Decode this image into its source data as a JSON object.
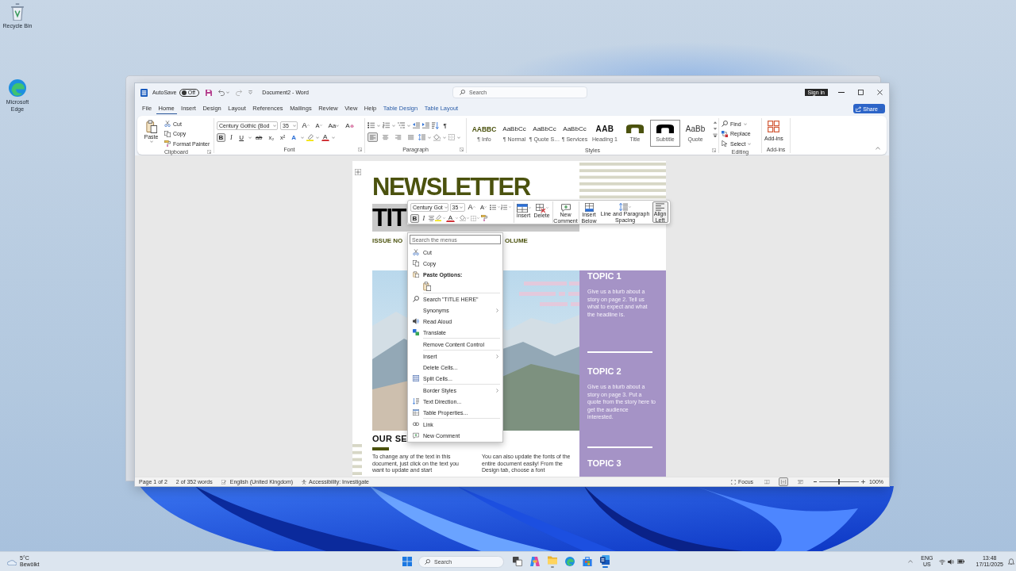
{
  "desktop_icons": [
    {
      "label": "Recycle Bin"
    },
    {
      "label": "Microsoft Edge"
    }
  ],
  "word_window": {
    "title_bar": {
      "autosave_label": "AutoSave",
      "autosave_toggle": {
        "label": "Off",
        "on": false
      },
      "document_title": "Document2 - Word",
      "search": {
        "placeholder": "Search"
      },
      "sign_in": "Sign in"
    },
    "tabs": [
      {
        "label": "File",
        "selected": false,
        "contextual": false
      },
      {
        "label": "Home",
        "selected": true,
        "contextual": false
      },
      {
        "label": "Insert",
        "selected": false,
        "contextual": false
      },
      {
        "label": "Design",
        "selected": false,
        "contextual": false
      },
      {
        "label": "Layout",
        "selected": false,
        "contextual": false
      },
      {
        "label": "References",
        "selected": false,
        "contextual": false
      },
      {
        "label": "Mailings",
        "selected": false,
        "contextual": false
      },
      {
        "label": "Review",
        "selected": false,
        "contextual": false
      },
      {
        "label": "View",
        "selected": false,
        "contextual": false
      },
      {
        "label": "Help",
        "selected": false,
        "contextual": false
      },
      {
        "label": "Table Design",
        "selected": false,
        "contextual": true
      },
      {
        "label": "Table Layout",
        "selected": false,
        "contextual": true
      }
    ],
    "share": "Share",
    "ribbon": {
      "clipboard": {
        "paste": "Paste",
        "commands": [
          "Cut",
          "Copy",
          "Format Painter"
        ],
        "label": "Clipboard"
      },
      "font": {
        "font_name": "Century Gothic (Bod",
        "font_size": "35",
        "grow": "A",
        "shrink": "A",
        "change_case": "Aa",
        "clear_formatting": "A",
        "bold": {
          "text": "B",
          "selected": true
        },
        "italic": {
          "text": "I",
          "selected": false
        },
        "underline": {
          "text": "U",
          "selected": false
        },
        "strikethrough": "ab",
        "subscript": "x₂",
        "superscript": "x²",
        "text_effects": "A",
        "font_color": "A",
        "label": "Font"
      },
      "paragraph": {
        "show_marks": "¶",
        "alignment": [
          {
            "selected": true
          },
          {
            "selected": false
          },
          {
            "selected": false
          },
          {
            "selected": false
          }
        ],
        "label": "Paragraph"
      },
      "styles": {
        "items": [
          {
            "preview": "AABBC",
            "name": "¶ Info",
            "kind": "accent",
            "color": "#4b520e",
            "selected": false
          },
          {
            "preview": "AaBbCc",
            "name": "¶ Normal",
            "kind": "plain",
            "selected": false
          },
          {
            "preview": "AaBbCc",
            "name": "¶ Quote S…",
            "kind": "plain",
            "selected": false
          },
          {
            "preview": "AaBbCc",
            "name": "¶ Services",
            "kind": "plain",
            "selected": false
          },
          {
            "preview": "AAB",
            "name": "Heading 1",
            "kind": "heading",
            "selected": false
          },
          {
            "name": "Title",
            "kind": "arch",
            "color": "#4b520e",
            "selected": false
          },
          {
            "name": "Subtitle",
            "kind": "arch",
            "color": "#000000",
            "selected": true
          },
          {
            "preview": "AaBb",
            "name": "Quote",
            "kind": "large",
            "selected": false
          }
        ],
        "label": "Styles"
      },
      "editing": {
        "commands": [
          "Find",
          "Replace",
          "Select"
        ],
        "label": "Editing"
      },
      "add_ins": {
        "button": "Add-ins",
        "label": "Add-ins"
      }
    },
    "document": {
      "title": "NEWSLETTER",
      "title_line_2": {
        "text": "TIT",
        "selected": true
      },
      "issue": "ISSUE NO",
      "volume": "OLUME",
      "section_heading": "OUR SE",
      "columns": [
        "To change any of the text in this document, just click on the text you want to update and start",
        "You can also update the fonts of the entire document easily! From the Design tab, choose a font"
      ],
      "topics": [
        {
          "heading": "TOPIC 1",
          "blurb": "Give us a blurb about a story on page 2. Tell us what to expect and what the headline is."
        },
        {
          "heading": "TOPIC 2",
          "blurb": "Give us a blurb about a story on page 3. Put a quote from the story here to get the audience interested."
        },
        {
          "heading": "TOPIC 3"
        }
      ]
    },
    "mini_toolbar": {
      "font_name": "Century Got",
      "font_size": "35",
      "grow": "A",
      "shrink": "A",
      "bold": {
        "text": "B",
        "selected": true
      },
      "italic": {
        "text": "I",
        "selected": false
      },
      "font_color": "A",
      "actions": [
        {
          "label": "Insert",
          "selected": false
        },
        {
          "label": "Delete",
          "selected": false
        },
        {
          "label": "New Comment",
          "selected": false
        },
        {
          "label": "Insert Below",
          "selected": false
        },
        {
          "label": "Line and Paragraph Spacing",
          "selected": false
        },
        {
          "label": "Align Left",
          "selected": true
        }
      ]
    },
    "context_menu": {
      "search": {
        "placeholder": "Search the menus"
      },
      "groups": [
        [
          {
            "kind": "command",
            "label": "Cut",
            "submenu": false
          },
          {
            "kind": "command",
            "label": "Copy",
            "submenu": false
          },
          {
            "kind": "heading",
            "label": "Paste Options:",
            "submenu": false
          },
          {
            "kind": "paste"
          }
        ],
        [
          {
            "kind": "command",
            "label": "Search \"TITLE HERE\"",
            "submenu": false
          },
          {
            "kind": "command",
            "label": "Synonyms",
            "submenu": true
          },
          {
            "kind": "command",
            "label": "Read Aloud",
            "submenu": false
          },
          {
            "kind": "command",
            "label": "Translate",
            "submenu": false
          }
        ],
        [
          {
            "kind": "command",
            "label": "Remove Content Control",
            "submenu": false
          }
        ],
        [
          {
            "kind": "command",
            "label": "Insert",
            "submenu": true
          },
          {
            "kind": "command",
            "label": "Delete Cells...",
            "submenu": false
          },
          {
            "kind": "command",
            "label": "Split Cells...",
            "submenu": false
          }
        ],
        [
          {
            "kind": "command",
            "label": "Border Styles",
            "submenu": true
          },
          {
            "kind": "command",
            "label": "Text Direction...",
            "submenu": false
          },
          {
            "kind": "command",
            "label": "Table Properties...",
            "submenu": false
          }
        ],
        [
          {
            "kind": "command",
            "label": "Link",
            "submenu": false
          },
          {
            "kind": "command",
            "label": "New Comment",
            "submenu": false
          }
        ]
      ]
    },
    "status_bar": {
      "page": "Page 1 of 2",
      "words": "2 of 352 words",
      "language": "English (United Kingdom)",
      "accessibility": "Accessibility: Investigate",
      "focus": "Focus",
      "views": [
        {
          "selected": false
        },
        {
          "selected": true
        },
        {
          "selected": false
        }
      ],
      "zoom": {
        "level": 0.5,
        "reading": "100%"
      }
    }
  },
  "taskbar": {
    "weather": {
      "temperature": "5°C",
      "condition": "Bewölkt"
    },
    "search": {
      "placeholder": "Search"
    },
    "apps": [
      {
        "running": false,
        "selected": false
      },
      {
        "running": false,
        "selected": false
      },
      {
        "running": true,
        "selected": false
      },
      {
        "running": false,
        "selected": false
      },
      {
        "running": false,
        "selected": false
      },
      {
        "running": true,
        "selected": true
      }
    ],
    "language": {
      "input": "ENG",
      "region": "US"
    },
    "clock": {
      "time": "13:48",
      "date": "17/11/2025"
    }
  }
}
